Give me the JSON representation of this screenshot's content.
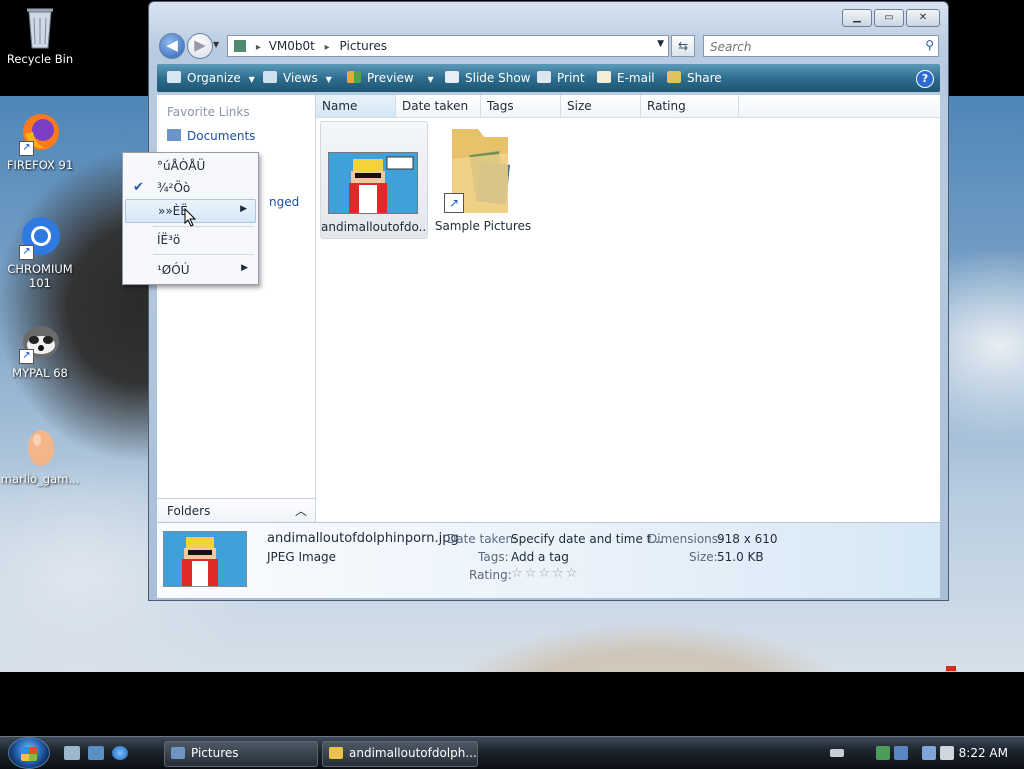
{
  "desktop": {
    "icons": [
      {
        "label": "Recycle Bin",
        "icon": "recycle-bin-icon"
      },
      {
        "label": "FIREFOX 91",
        "icon": "firefox-icon"
      },
      {
        "label": "CHROMIUM\n101",
        "icon": "chromium-icon"
      },
      {
        "label": "MYPAL 68",
        "icon": "mypal-icon"
      },
      {
        "label": "marlio_gam...",
        "icon": "egg-icon"
      }
    ]
  },
  "window": {
    "title_buttons": [
      "minimize",
      "maximize",
      "close"
    ],
    "address": {
      "computer": "VM0b0t",
      "separator": "▸",
      "folder": "Pictures"
    },
    "search_placeholder": "Search",
    "toolbar": {
      "organize": "Organize",
      "views": "Views",
      "preview": "Preview",
      "slideshow": "Slide Show",
      "print": "Print",
      "email": "E-mail",
      "share": "Share",
      "help": "?"
    },
    "nav": {
      "favorite_links": "Favorite Links",
      "documents": "Documents",
      "partial_link": "nged",
      "folders": "Folders"
    },
    "columns": [
      "Name",
      "Date taken",
      "Tags",
      "Size",
      "Rating"
    ],
    "items": [
      {
        "label": "andimalloutofdo...",
        "type": "image"
      },
      {
        "label": "Sample Pictures",
        "type": "folder-shortcut"
      }
    ],
    "details": {
      "filename": "andimalloutofdolphinporn.jpg",
      "filetype": "JPEG Image",
      "date_taken_label": "Date taken:",
      "date_taken_value": "Specify date and time t...",
      "tags_label": "Tags:",
      "tags_value": "Add a tag",
      "rating_label": "Rating:",
      "rating_value": 0,
      "dimensions_label": "Dimensions:",
      "dimensions_value": "918 x 610",
      "size_label": "Size:",
      "size_value": "51.0 KB"
    }
  },
  "context_menu": {
    "items": [
      {
        "label": "°úÅÒÅÜ",
        "checked": false,
        "submenu": false
      },
      {
        "label": "¾²Öò",
        "checked": true,
        "submenu": false
      },
      {
        "label": "»»ÈË",
        "checked": false,
        "submenu": true,
        "hover": true
      },
      {
        "label": "ÍË³ö",
        "checked": false,
        "submenu": false
      },
      {
        "label": "¹ØÓÚ",
        "checked": false,
        "submenu": true
      }
    ]
  },
  "taskbar": {
    "tasks": [
      {
        "label": "Pictures"
      },
      {
        "label": "andimalloutofdolph..."
      }
    ],
    "clock": "8:22 AM"
  },
  "colors": {
    "toolbar": "#2f6e8f",
    "link": "#1d4fa2",
    "taskbar": "#1b232c"
  }
}
